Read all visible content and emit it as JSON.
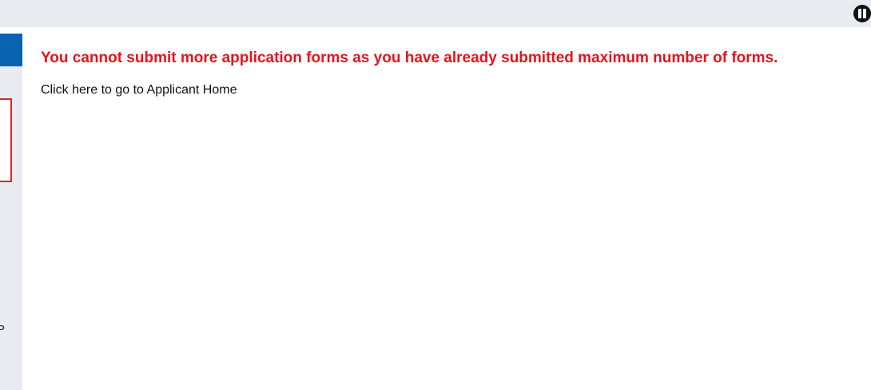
{
  "header": {
    "pause_icon": "pause-icon"
  },
  "sidebar": {
    "fragment_text": "P"
  },
  "main": {
    "error_message": "You cannot submit more application forms as you have already submitted maximum number of forms.",
    "home_link_label": "Click here to go to Applicant Home"
  },
  "colors": {
    "error_text": "#e3151a",
    "sidebar_header": "#0a63b0",
    "top_bar": "#e8ebef",
    "sidebar_box_border": "#d9262a"
  }
}
